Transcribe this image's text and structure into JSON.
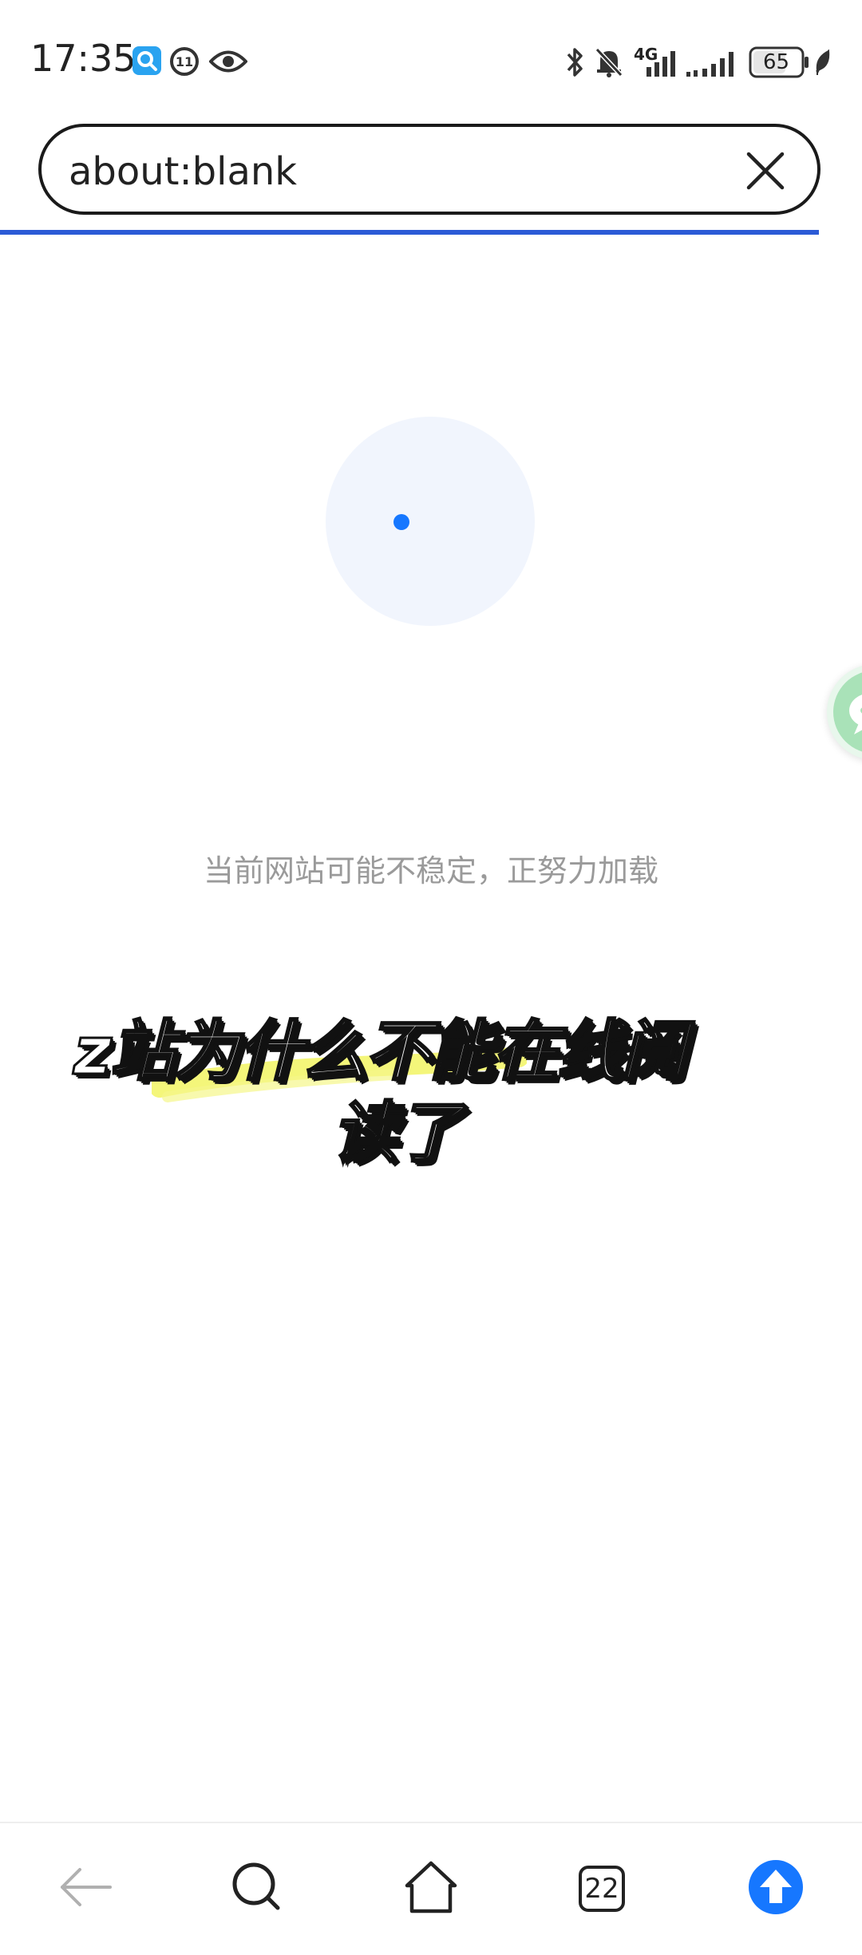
{
  "status_bar": {
    "time": "17:35",
    "network": "4G",
    "battery": "65"
  },
  "browser": {
    "url": "about:blank",
    "loading_message": "当前网站可能不稳定，正努力加载"
  },
  "caption": {
    "line1": "z站为什么不能在线阅",
    "line2": "读了"
  },
  "bottom_nav": {
    "tab_count": "22"
  },
  "colors": {
    "accent": "#1677ff",
    "progress": "#2b5bd6",
    "highlight": "#f3f56b"
  }
}
